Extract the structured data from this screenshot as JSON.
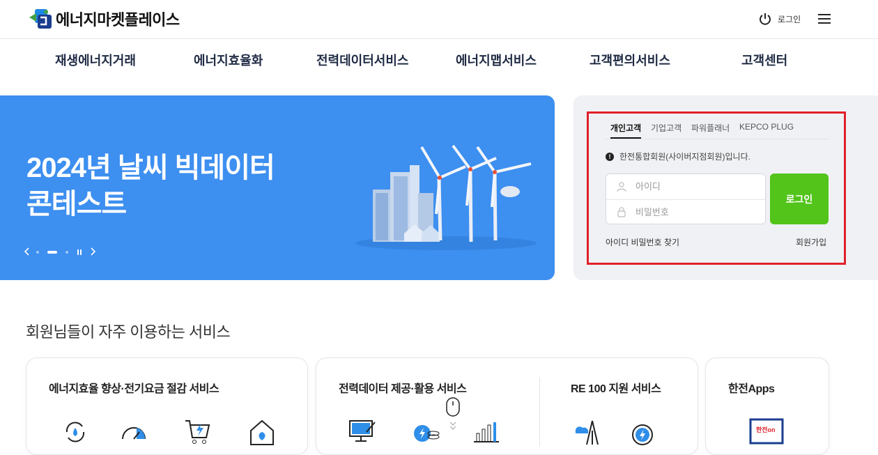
{
  "header": {
    "logo_text": "에너지마켓플레이스",
    "login_label": "로그인"
  },
  "nav": {
    "items": [
      {
        "label": "재생에너지거래"
      },
      {
        "label": "에너지효율화"
      },
      {
        "label": "전력데이터서비스"
      },
      {
        "label": "에너지맵서비스"
      },
      {
        "label": "고객편의서비스"
      },
      {
        "label": "고객센터"
      }
    ]
  },
  "banner": {
    "title_line1": "2024년 날씨 빅데이터",
    "title_line2": "콘테스트",
    "slide_count": 3,
    "active_slide": 2
  },
  "login": {
    "tabs": [
      {
        "label": "개인고객",
        "active": true
      },
      {
        "label": "기업고객",
        "active": false
      },
      {
        "label": "파워플래너",
        "active": false
      },
      {
        "label": "KEPCO PLUG",
        "active": false
      }
    ],
    "notice": "한전통합회원(사이버지점회원)입니다.",
    "id_placeholder": "아이디",
    "pw_placeholder": "비밀번호",
    "button_label": "로그인",
    "find_label": "아이디 비밀번호 찾기",
    "join_label": "회원가입"
  },
  "services": {
    "section_title": "회원님들이 자주 이용하는 서비스",
    "cards": [
      {
        "title": "에너지효율 향상·전기요금 절감 서비스"
      },
      {
        "title": "전력데이터 제공·활용 서비스"
      },
      {
        "title": "RE 100 지원 서비스"
      },
      {
        "title": "한전Apps"
      }
    ],
    "apps_icon_text": "한전on"
  },
  "colors": {
    "banner_bg": "#3d8ff0",
    "login_button": "#52c41a",
    "highlight_border": "#e0202a",
    "panel_bg": "#f0f1f4",
    "nav_text": "#1f2a44"
  }
}
